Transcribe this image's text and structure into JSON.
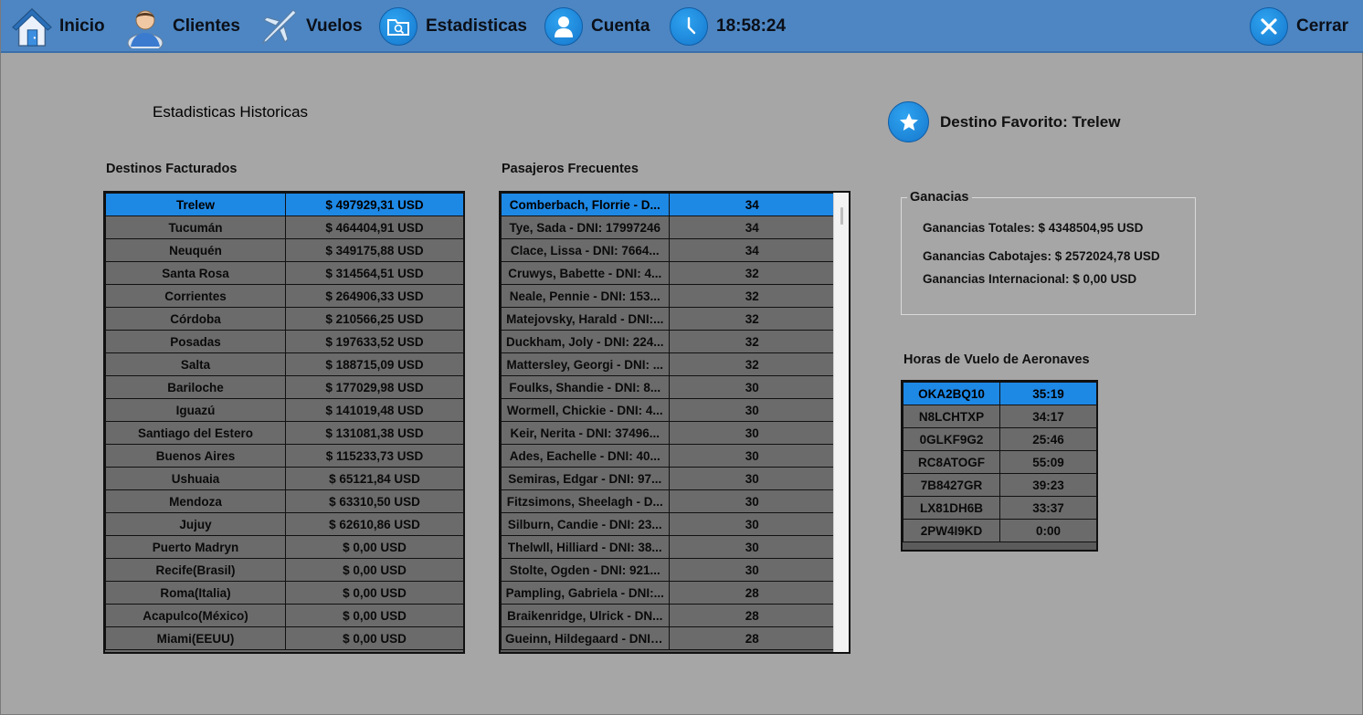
{
  "nav": {
    "inicio": "Inicio",
    "clientes": "Clientes",
    "vuelos": "Vuelos",
    "estadisticas": "Estadisticas",
    "cuenta": "Cuenta",
    "clock": "18:58:24",
    "cerrar": "Cerrar"
  },
  "page": {
    "title": "Estadisticas Historicas",
    "favorite": "Destino Favorito: Trelew"
  },
  "destinos": {
    "label": "Destinos Facturados",
    "rows": [
      [
        "Trelew",
        "$ 497929,31 USD"
      ],
      [
        "Tucumán",
        "$ 464404,91 USD"
      ],
      [
        "Neuquén",
        "$ 349175,88 USD"
      ],
      [
        "Santa Rosa",
        "$ 314564,51 USD"
      ],
      [
        "Corrientes",
        "$ 264906,33 USD"
      ],
      [
        "Córdoba",
        "$ 210566,25 USD"
      ],
      [
        "Posadas",
        "$ 197633,52 USD"
      ],
      [
        "Salta",
        "$ 188715,09 USD"
      ],
      [
        "Bariloche",
        "$ 177029,98 USD"
      ],
      [
        "Iguazú",
        "$ 141019,48 USD"
      ],
      [
        "Santiago del Estero",
        "$ 131081,38 USD"
      ],
      [
        "Buenos Aires",
        "$ 115233,73 USD"
      ],
      [
        "Ushuaia",
        "$ 65121,84 USD"
      ],
      [
        "Mendoza",
        "$ 63310,50 USD"
      ],
      [
        "Jujuy",
        "$ 62610,86 USD"
      ],
      [
        "Puerto Madryn",
        "$ 0,00 USD"
      ],
      [
        "Recife(Brasil)",
        "$ 0,00 USD"
      ],
      [
        "Roma(Italia)",
        "$ 0,00 USD"
      ],
      [
        "Acapulco(México)",
        "$ 0,00 USD"
      ],
      [
        "Miami(EEUU)",
        "$ 0,00 USD"
      ]
    ]
  },
  "pasajeros": {
    "label": "Pasajeros Frecuentes",
    "rows": [
      [
        "Comberbach, Florrie - D...",
        "34"
      ],
      [
        "Tye, Sada - DNI: 17997246",
        "34"
      ],
      [
        "Clace, Lissa - DNI: 7664...",
        "34"
      ],
      [
        "Cruwys, Babette - DNI: 4...",
        "32"
      ],
      [
        "Neale, Pennie - DNI: 153...",
        "32"
      ],
      [
        "Matejovsky, Harald - DNI:...",
        "32"
      ],
      [
        "Duckham, Joly - DNI: 224...",
        "32"
      ],
      [
        "Mattersley, Georgi - DNI: ...",
        "32"
      ],
      [
        "Foulks, Shandie - DNI: 8...",
        "30"
      ],
      [
        "Wormell, Chickie - DNI: 4...",
        "30"
      ],
      [
        "Keir, Nerita - DNI: 37496...",
        "30"
      ],
      [
        "Ades, Eachelle - DNI: 40...",
        "30"
      ],
      [
        "Semiras, Edgar - DNI: 97...",
        "30"
      ],
      [
        "Fitzsimons, Sheelagh - D...",
        "30"
      ],
      [
        "Silburn, Candie - DNI: 23...",
        "30"
      ],
      [
        "Thelwll, Hilliard - DNI: 38...",
        "30"
      ],
      [
        "Stolte, Ogden - DNI: 921...",
        "30"
      ],
      [
        "Pampling, Gabriela - DNI:...",
        "28"
      ],
      [
        "Braikenridge, Ulrick - DN...",
        "28"
      ],
      [
        "Gueinn, Hildegaard - DNI:...",
        "28"
      ]
    ]
  },
  "ganancias": {
    "legend": "Ganacias",
    "totales": "Ganancias Totales: $ 4348504,95 USD",
    "cabotajes": "Ganancias Cabotajes: $ 2572024,78 USD",
    "internacional": "Ganancias Internacional: $ 0,00 USD"
  },
  "horas": {
    "label": "Horas de Vuelo de Aeronaves",
    "rows": [
      [
        "OKA2BQ10",
        "35:19"
      ],
      [
        "N8LCHTXP",
        "34:17"
      ],
      [
        "0GLKF9G2",
        "25:46"
      ],
      [
        "RC8ATOGF",
        "55:09"
      ],
      [
        "7B8427GR",
        "39:23"
      ],
      [
        "LX81DH6B",
        "33:37"
      ],
      [
        "2PW4I9KD",
        "0:00"
      ]
    ]
  },
  "colors": {
    "topbar": "#4d86c2",
    "selection": "#1e88e5",
    "background": "#a6a6a6",
    "row": "#6b6b6b"
  }
}
